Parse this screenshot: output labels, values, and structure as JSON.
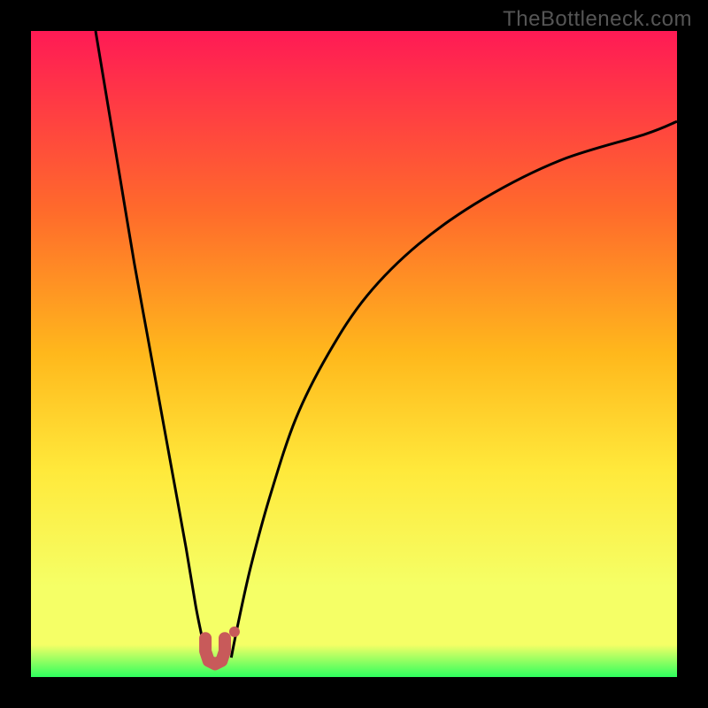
{
  "watermark": "TheBottleneck.com",
  "colors": {
    "background": "#000000",
    "watermark": "#555555",
    "curve": "#000000",
    "marker_fill": "#c85a5a",
    "marker_stroke": "#c85a5a",
    "gradient_top": "#ff1a55",
    "gradient_mid_upper": "#ff6b2b",
    "gradient_mid": "#ffb81c",
    "gradient_mid_lower": "#ffe93b",
    "gradient_lower": "#f5ff66",
    "gradient_bottom": "#2eff5e"
  },
  "chart_data": {
    "type": "line",
    "title": "",
    "xlabel": "",
    "ylabel": "",
    "xlim": [
      0,
      100
    ],
    "ylim": [
      0,
      100
    ],
    "series": [
      {
        "name": "left-curve",
        "x": [
          10,
          12,
          14,
          16,
          18,
          20,
          22,
          24,
          25.5,
          26.5,
          27
        ],
        "y": [
          100,
          88,
          76,
          64,
          53,
          42,
          31,
          20,
          11,
          6,
          3
        ]
      },
      {
        "name": "right-curve",
        "x": [
          31,
          32,
          34,
          37,
          41,
          46,
          52,
          60,
          70,
          82,
          95,
          100
        ],
        "y": [
          3,
          8,
          17,
          28,
          40,
          50,
          59,
          67,
          74,
          80,
          84,
          86
        ]
      },
      {
        "name": "minimum-region-markers",
        "type": "scatter-path",
        "x": [
          27,
          27,
          27.5,
          28.5,
          29.5,
          30,
          30,
          31.5
        ],
        "y": [
          6,
          4,
          2.5,
          2,
          2.5,
          4,
          6,
          7
        ]
      }
    ]
  }
}
